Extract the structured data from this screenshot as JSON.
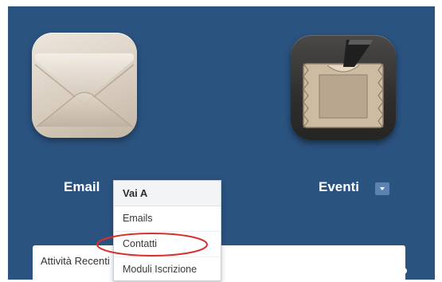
{
  "apps": {
    "email": {
      "label": "Email",
      "icon": "envelope-icon"
    },
    "events": {
      "label": "Eventi",
      "icon": "ticket-icon"
    }
  },
  "dropdown": {
    "header": "Vai A",
    "items": [
      "Emails",
      "Contatti",
      "Moduli Iscrizione"
    ]
  },
  "activity": {
    "title": "Attività Recenti"
  },
  "colors": {
    "background": "#2b5380",
    "highlight": "#d9302c",
    "caret_button": "#5b82b0"
  }
}
